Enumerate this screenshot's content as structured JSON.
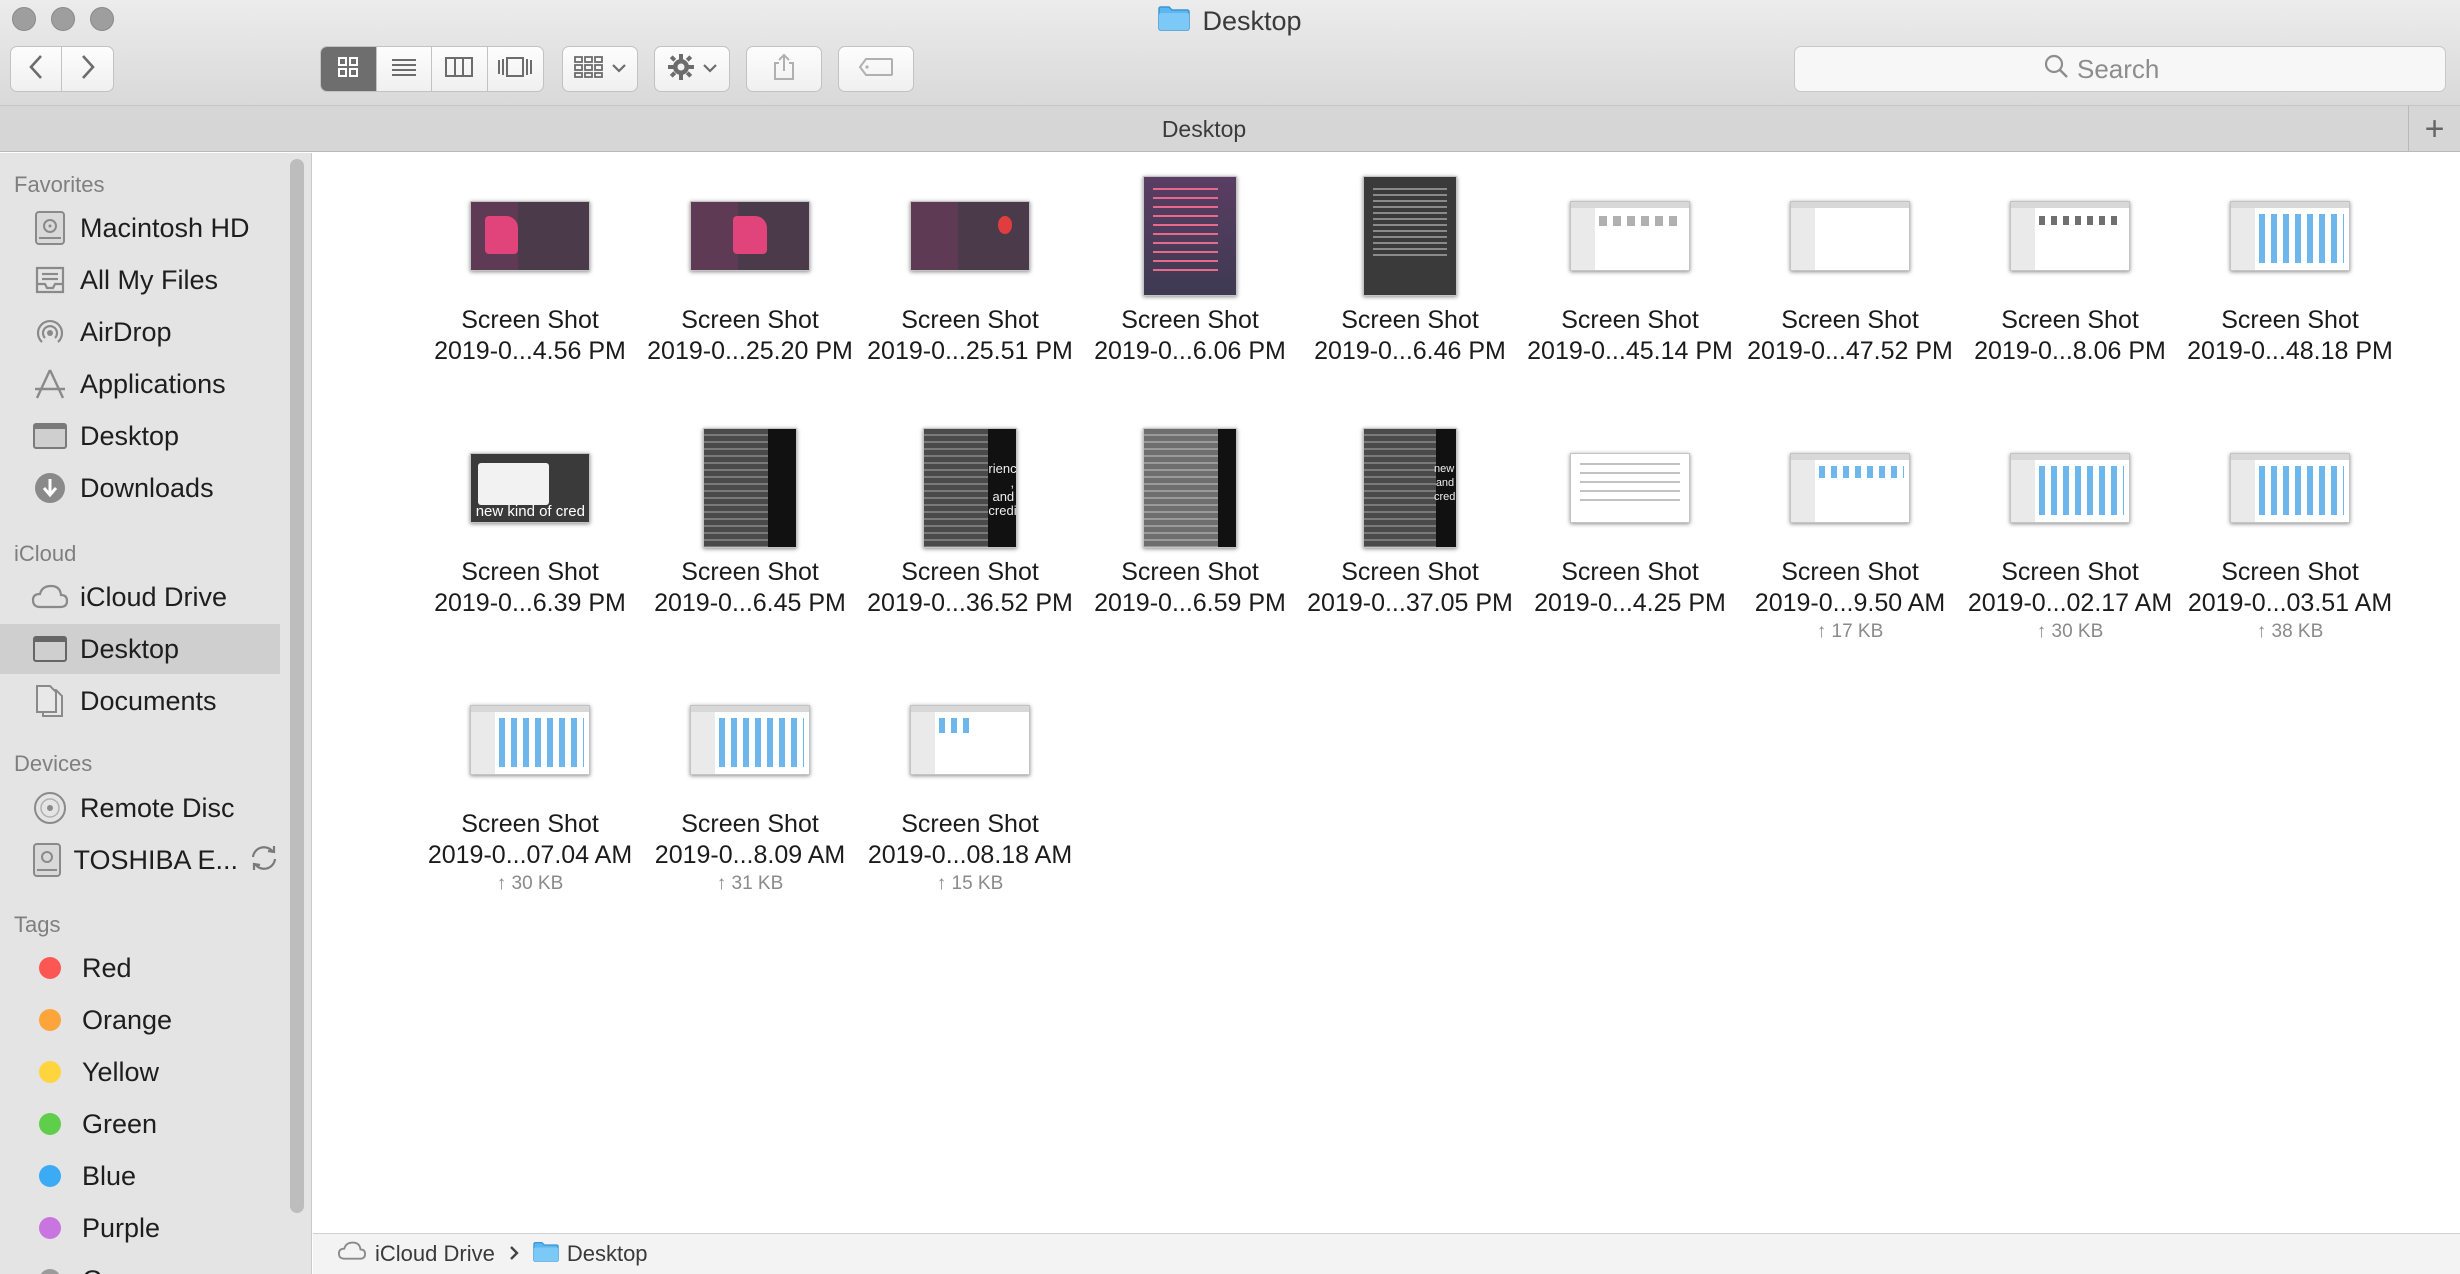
{
  "window": {
    "title": "Desktop"
  },
  "toolbar": {
    "back_icon": "chevron-left-icon",
    "forward_icon": "chevron-right-icon",
    "view_modes": [
      "icon-view",
      "list-view",
      "column-view",
      "coverflow-view"
    ],
    "active_view": "icon-view",
    "search": {
      "placeholder": "Search"
    }
  },
  "tabbar": {
    "title": "Desktop",
    "add_label": "+"
  },
  "sidebar": {
    "sections": [
      {
        "title": "Favorites",
        "items": [
          {
            "label": "Macintosh HD",
            "icon": "hard-drive-icon"
          },
          {
            "label": "All My Files",
            "icon": "all-files-icon"
          },
          {
            "label": "AirDrop",
            "icon": "airdrop-icon"
          },
          {
            "label": "Applications",
            "icon": "applications-icon"
          },
          {
            "label": "Desktop",
            "icon": "desktop-icon"
          },
          {
            "label": "Downloads",
            "icon": "downloads-icon"
          }
        ]
      },
      {
        "title": "iCloud",
        "items": [
          {
            "label": "iCloud Drive",
            "icon": "cloud-icon"
          },
          {
            "label": "Desktop",
            "icon": "desktop-icon",
            "selected": true
          },
          {
            "label": "Documents",
            "icon": "documents-icon"
          }
        ]
      },
      {
        "title": "Devices",
        "items": [
          {
            "label": "Remote Disc",
            "icon": "disc-icon"
          },
          {
            "label": "TOSHIBA E...",
            "icon": "external-drive-icon"
          }
        ]
      },
      {
        "title": "Tags",
        "items": [
          {
            "label": "Red",
            "color": "#fc5753"
          },
          {
            "label": "Orange",
            "color": "#fda43a"
          },
          {
            "label": "Yellow",
            "color": "#fed53c"
          },
          {
            "label": "Green",
            "color": "#5fce4b"
          },
          {
            "label": "Blue",
            "color": "#3aabf4"
          },
          {
            "label": "Purple",
            "color": "#c875e0"
          },
          {
            "label": "Gray",
            "color": "#9b9b9b"
          }
        ]
      }
    ]
  },
  "files": [
    {
      "line1": "Screen Shot",
      "line2": "2019-0...4.56 PM",
      "size": ""
    },
    {
      "line1": "Screen Shot",
      "line2": "2019-0...25.20 PM",
      "size": ""
    },
    {
      "line1": "Screen Shot",
      "line2": "2019-0...25.51 PM",
      "size": ""
    },
    {
      "line1": "Screen Shot",
      "line2": "2019-0...6.06 PM",
      "size": ""
    },
    {
      "line1": "Screen Shot",
      "line2": "2019-0...6.46 PM",
      "size": ""
    },
    {
      "line1": "Screen Shot",
      "line2": "2019-0...45.14 PM",
      "size": ""
    },
    {
      "line1": "Screen Shot",
      "line2": "2019-0...47.52 PM",
      "size": ""
    },
    {
      "line1": "Screen Shot",
      "line2": "2019-0...8.06 PM",
      "size": ""
    },
    {
      "line1": "Screen Shot",
      "line2": "2019-0...48.18 PM",
      "size": ""
    },
    {
      "line1": "Screen Shot",
      "line2": "2019-0...6.39 PM",
      "size": "",
      "thumb_text": "new kind of credi"
    },
    {
      "line1": "Screen Shot",
      "line2": "2019-0...6.45 PM",
      "size": ""
    },
    {
      "line1": "Screen Shot",
      "line2": "2019-0...36.52 PM",
      "size": "",
      "thumb_text": "rience , and credit"
    },
    {
      "line1": "Screen Shot",
      "line2": "2019-0...6.59 PM",
      "size": ""
    },
    {
      "line1": "Screen Shot",
      "line2": "2019-0...37.05 PM",
      "size": "",
      "thumb_text": "new and credit"
    },
    {
      "line1": "Screen Shot",
      "line2": "2019-0...4.25 PM",
      "size": ""
    },
    {
      "line1": "Screen Shot",
      "line2": "2019-0...9.50 AM",
      "size": "↑ 17 KB"
    },
    {
      "line1": "Screen Shot",
      "line2": "2019-0...02.17 AM",
      "size": "↑ 30 KB"
    },
    {
      "line1": "Screen Shot",
      "line2": "2019-0...03.51 AM",
      "size": "↑ 38 KB"
    },
    {
      "line1": "Screen Shot",
      "line2": "2019-0...07.04 AM",
      "size": "↑ 30 KB"
    },
    {
      "line1": "Screen Shot",
      "line2": "2019-0...8.09 AM",
      "size": "↑ 31 KB"
    },
    {
      "line1": "Screen Shot",
      "line2": "2019-0...08.18 AM",
      "size": "↑ 15 KB"
    }
  ],
  "pathbar": [
    {
      "label": "iCloud Drive",
      "icon": "cloud-icon"
    },
    {
      "label": "Desktop",
      "icon": "folder-icon"
    }
  ]
}
